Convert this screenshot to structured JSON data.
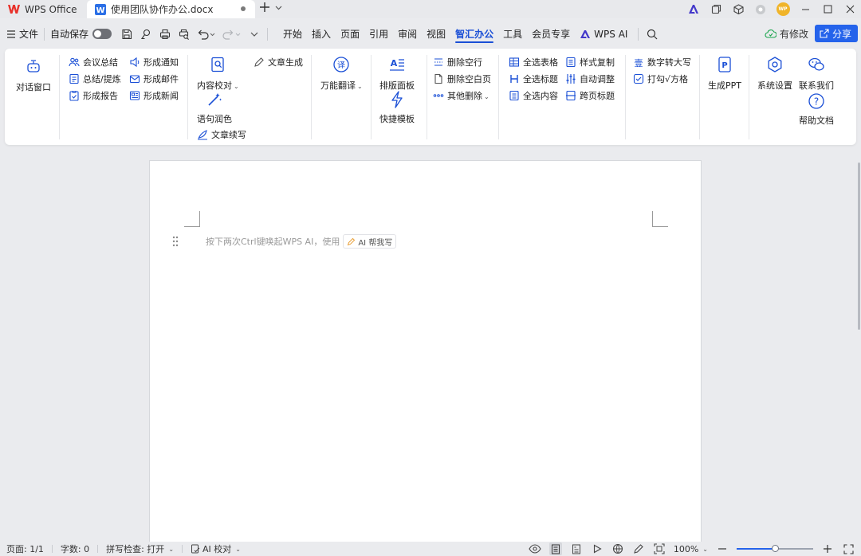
{
  "titlebar": {
    "home_tab_label": "WPS Office",
    "doc_tab_label": "使用团队协作办公.docx",
    "avatar_text": "WP"
  },
  "menubar": {
    "file_label": "文件",
    "autosave_label": "自动保存",
    "tabs": [
      "开始",
      "插入",
      "页面",
      "引用",
      "审阅",
      "视图",
      "智汇办公",
      "工具",
      "会员专享"
    ],
    "active_tab": "智汇办公",
    "wps_ai_label": "WPS AI",
    "revise_label": "有修改",
    "share_label": "分享"
  },
  "ribbon": {
    "dialog_window": "对话窗口",
    "meeting_summary": "会议总结",
    "summary_extract": "总结/提炼",
    "form_report": "形成报告",
    "form_notice": "形成通知",
    "form_email": "形成邮件",
    "form_news": "形成新闻",
    "content_proofread": "内容校对",
    "article_generate": "文章生成",
    "sentence_polish": "语句润色",
    "article_continue": "文章续写",
    "universal_translate": "万能翻译",
    "layout_panel": "排版面板",
    "quick_template": "快捷模板",
    "delete_empty_lines": "删除空行",
    "delete_blank_pages": "删除空白页",
    "other_delete": "其他删除",
    "select_all_tables": "全选表格",
    "select_all_headings": "全选标题",
    "select_all_content": "全选内容",
    "style_copy": "样式复制",
    "auto_adjust": "自动调整",
    "cross_page_heading": "跨页标题",
    "number_to_upper": "数字转大写",
    "check_box": "打勾√方格",
    "generate_ppt": "生成PPT",
    "system_settings": "系统设置",
    "contact_us": "联系我们",
    "help_doc": "帮助文档"
  },
  "document": {
    "hint_text": "按下两次Ctrl键唤起WPS AI，使用",
    "ai_chip_label": "AI 帮我写"
  },
  "statusbar": {
    "page": "页面: 1/1",
    "word_count": "字数: 0",
    "spell_check": "拼写检查: 打开",
    "ai_proofread": "AI 校对",
    "zoom": "100%",
    "zoom_fraction": 0.5
  },
  "colors": {
    "accent": "#1a4fd6",
    "share_button": "#2563eb",
    "wps_red": "#e8322b",
    "doc_icon_blue": "#2b6fe6"
  }
}
